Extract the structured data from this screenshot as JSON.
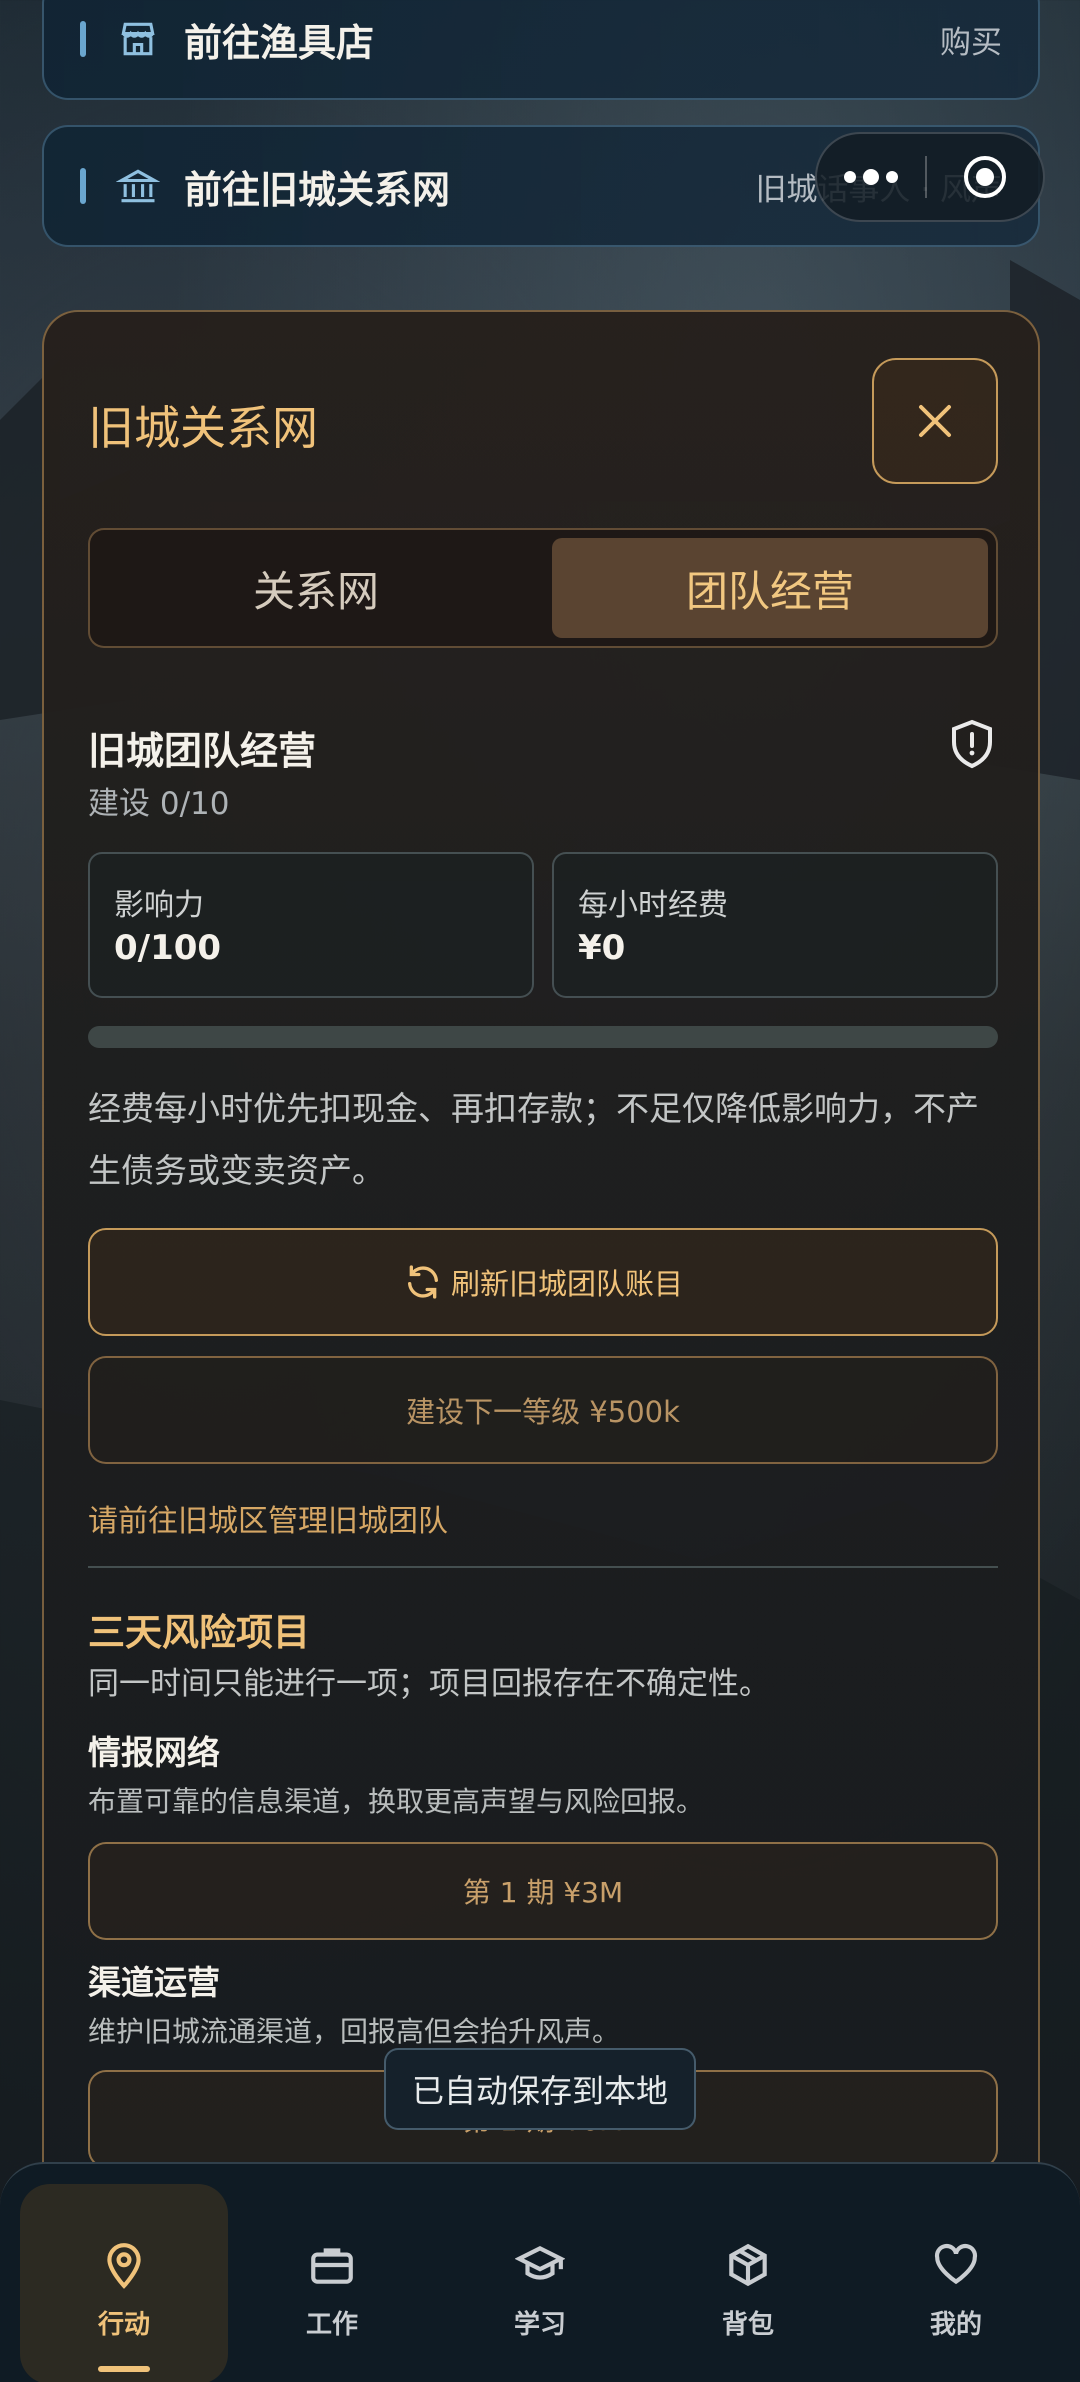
{
  "nav_cards": [
    {
      "title": "前往渔具店",
      "right_text": "购买",
      "icon": "store-icon"
    },
    {
      "title": "前往旧城关系网",
      "right_text": "旧城话事人 · 风声",
      "icon": "bank-icon"
    }
  ],
  "capsule": {
    "more_icon": "more-dots-icon",
    "record_icon": "target-icon"
  },
  "modal": {
    "title": "旧城关系网",
    "close_icon": "close-icon",
    "tabs": [
      {
        "label": "关系网",
        "active": false
      },
      {
        "label": "团队经营",
        "active": true
      }
    ],
    "section": {
      "title": "旧城团队经营",
      "build_level": "建设 0/10",
      "shield_icon": "shield-alert-icon"
    },
    "stats": [
      {
        "label": "影响力",
        "value": "0/100"
      },
      {
        "label": "每小时经费",
        "value": "¥0"
      }
    ],
    "progress_fraction": 0,
    "description": "经费每小时优先扣现金、再扣存款；不足仅降低影响力，不产生债务或变卖资产。",
    "refresh_button": "刷新旧城团队账目",
    "build_button": "建设下一等级 ¥500k",
    "hint": "请前往旧城区管理旧城团队",
    "risk": {
      "title": "三天风险项目",
      "subtitle": "同一时间只能进行一项；项目回报存在不确定性。",
      "projects": [
        {
          "title": "情报网络",
          "desc": "布置可靠的信息渠道，换取更高声望与风险回报。",
          "button": "第 1 期 ¥3M"
        },
        {
          "title": "渠道运营",
          "desc": "维护旧城流通渠道，回报高但会抬升风声。",
          "button": "第 1 期 ¥6M"
        }
      ]
    }
  },
  "toast": "已自动保存到本地",
  "tabbar": [
    {
      "label": "行动",
      "icon": "location-pin-icon",
      "active": true
    },
    {
      "label": "工作",
      "icon": "briefcase-icon",
      "active": false
    },
    {
      "label": "学习",
      "icon": "graduation-cap-icon",
      "active": false
    },
    {
      "label": "背包",
      "icon": "package-icon",
      "active": false
    },
    {
      "label": "我的",
      "icon": "heart-icon",
      "active": false
    }
  ],
  "colors": {
    "accent": "#f0c27a",
    "border_gold": "#c59a5a",
    "card_blue": "#6aa6cf"
  }
}
